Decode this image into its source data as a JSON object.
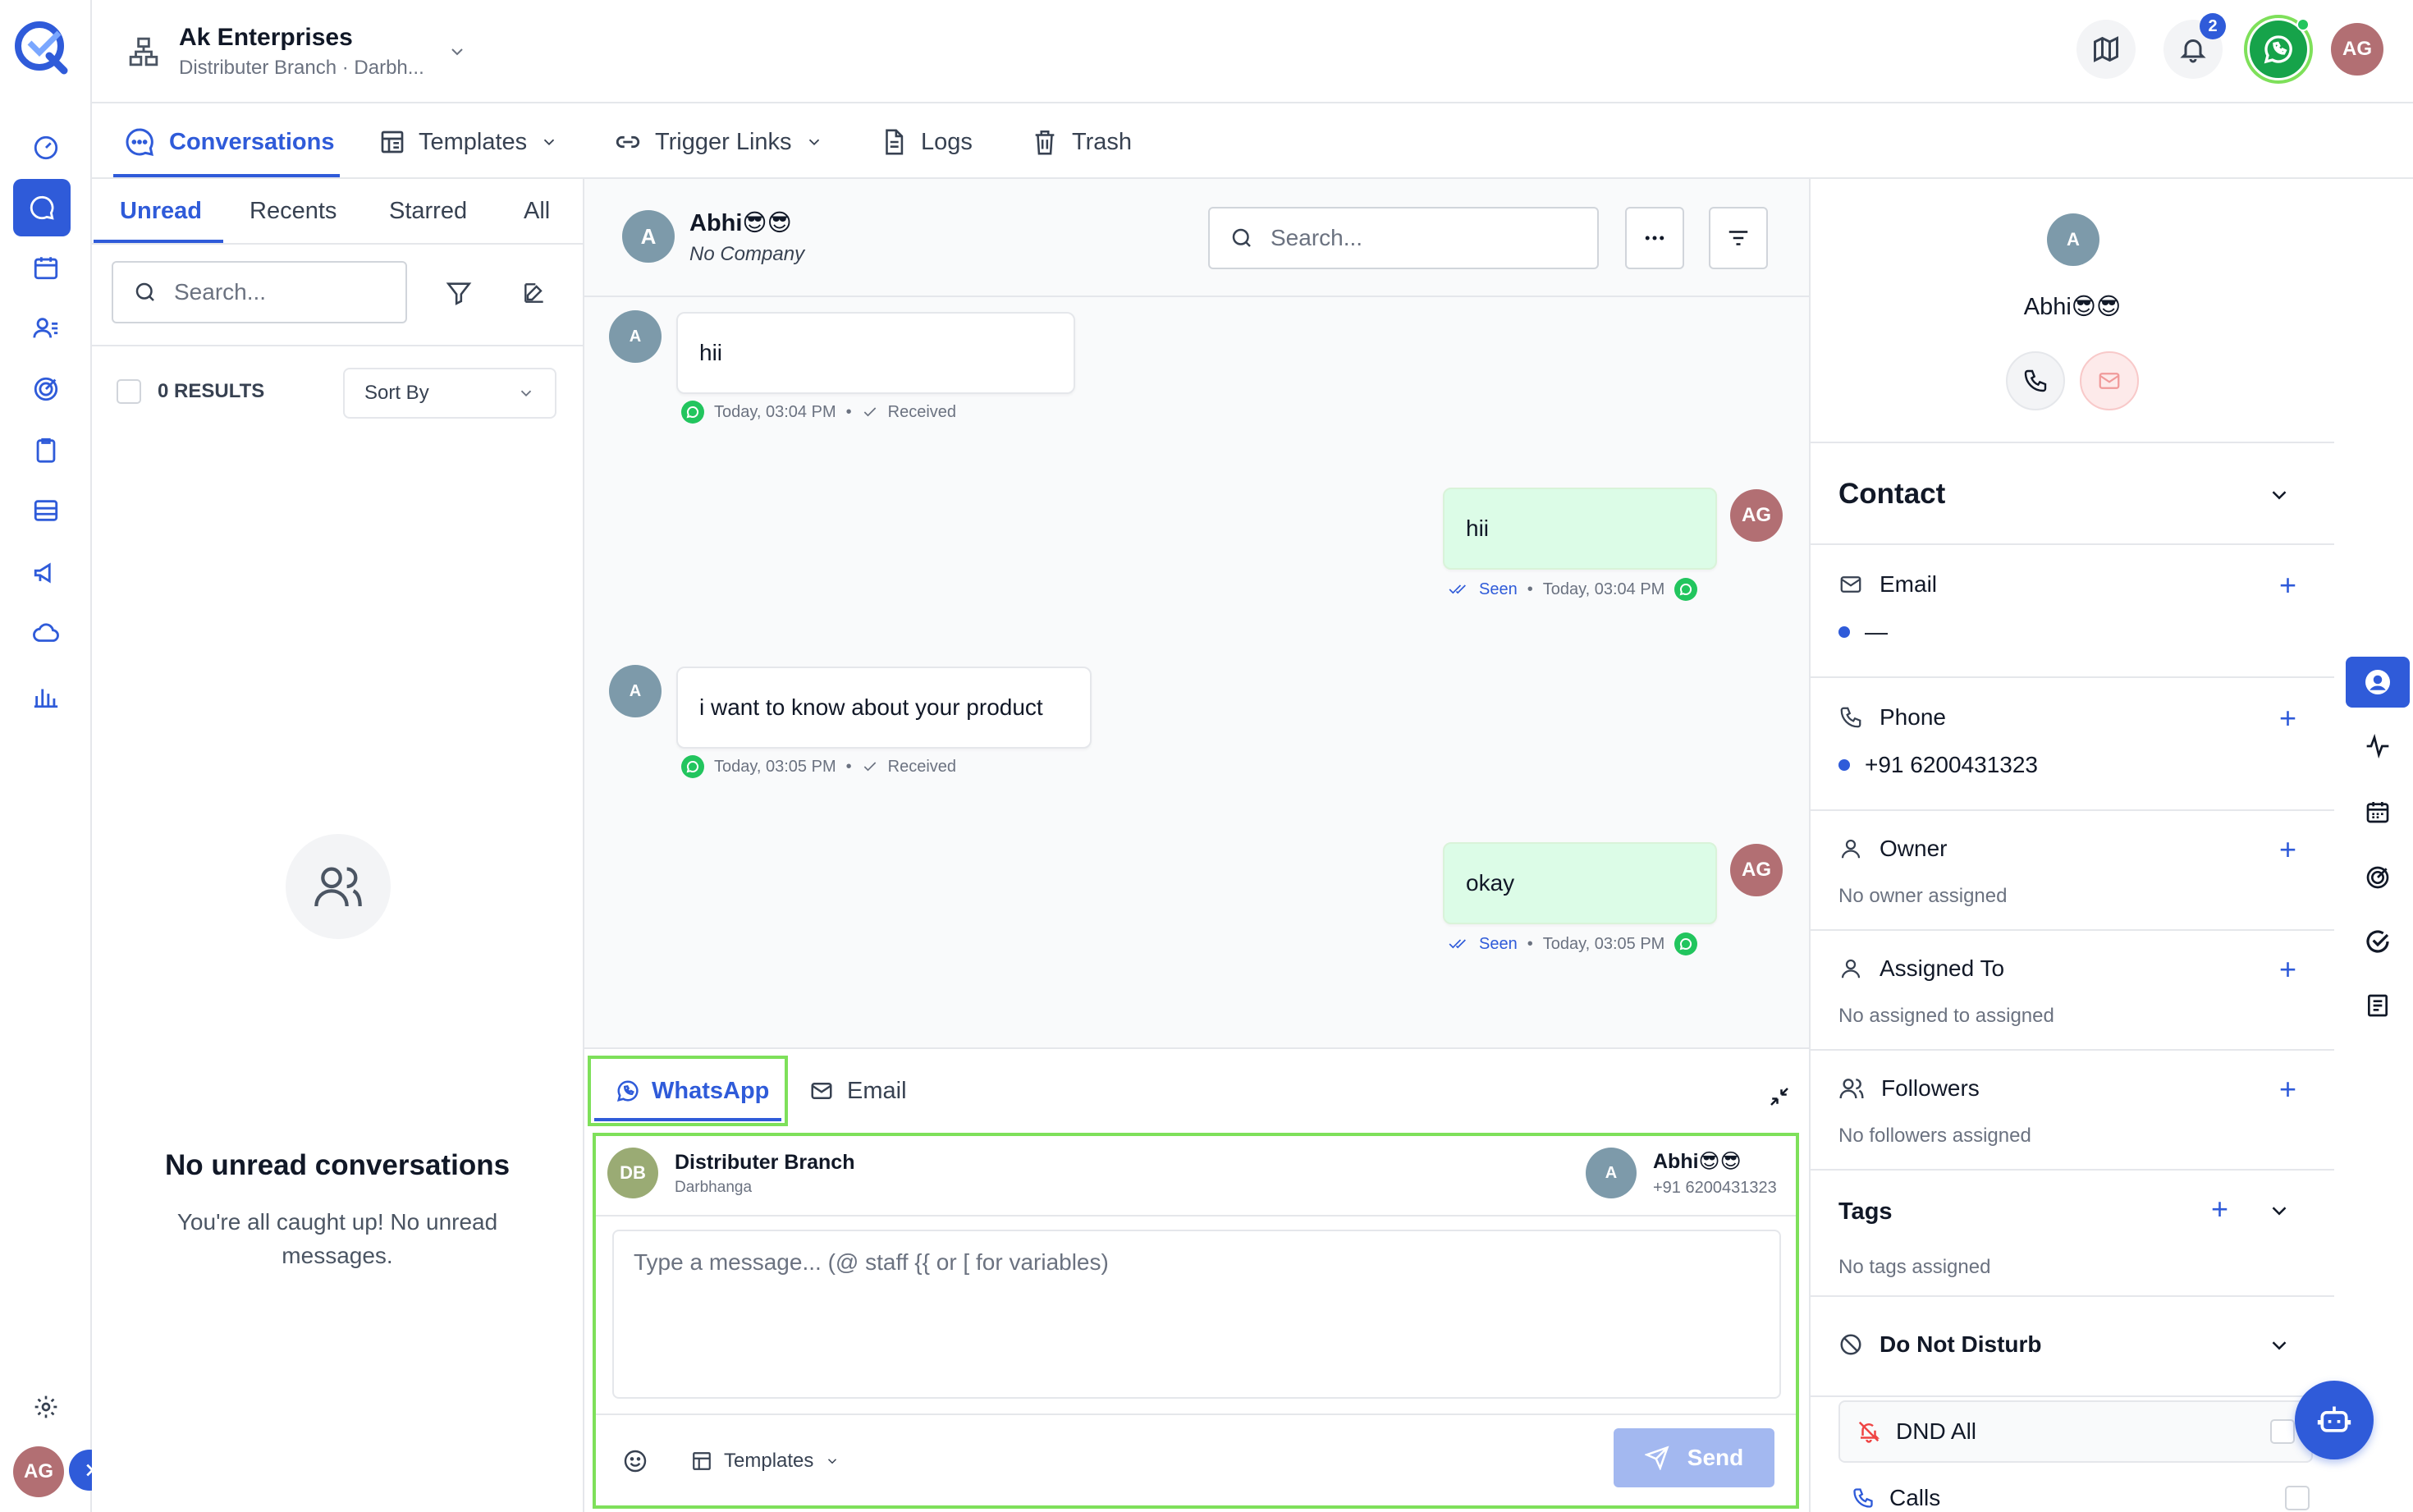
{
  "org": {
    "name": "Ak Enterprises",
    "subtitle": "Distributer Branch · Darbh..."
  },
  "header": {
    "notification_count": "2",
    "user_initials": "AG"
  },
  "nav_tabs": [
    {
      "label": "Conversations"
    },
    {
      "label": "Templates"
    },
    {
      "label": "Trigger Links"
    },
    {
      "label": "Logs"
    },
    {
      "label": "Trash"
    }
  ],
  "list": {
    "tabs": [
      "Unread",
      "Recents",
      "Starred",
      "All"
    ],
    "search_placeholder": "Search...",
    "results": "0 RESULTS",
    "sort_label": "Sort By",
    "empty_title": "No unread conversations",
    "empty_text": "You're all caught up! No unread messages."
  },
  "chat": {
    "contact_initial": "A",
    "contact_name": "Abhi😎😎",
    "contact_company": "No Company",
    "search_placeholder": "Search...",
    "messages": [
      {
        "text": "hii",
        "time": "Today, 03:04 PM",
        "status": "Received"
      },
      {
        "text": "hii",
        "time": "Today, 03:04 PM",
        "status": "Seen"
      },
      {
        "text": "i want to know about your product",
        "time": "Today, 03:05 PM",
        "status": "Received"
      },
      {
        "text": "okay",
        "time": "Today, 03:05 PM",
        "status": "Seen"
      }
    ]
  },
  "composer": {
    "channels": [
      "WhatsApp",
      "Email"
    ],
    "from_initials": "DB",
    "from_name": "Distributer Branch",
    "from_sub": "Darbhanga",
    "to_name": "Abhi😎😎",
    "to_phone": "+91 6200431323",
    "placeholder": "Type a message... (@ staff  {{ or [ for variables)",
    "templates_label": "Templates",
    "send_label": "Send"
  },
  "contact_panel": {
    "name": "Abhi😎😎",
    "section_title": "Contact",
    "email_label": "Email",
    "email_value": "—",
    "phone_label": "Phone",
    "phone_value": "+91 6200431323",
    "owner_label": "Owner",
    "owner_value": "No owner assigned",
    "assigned_label": "Assigned To",
    "assigned_value": "No assigned to assigned",
    "followers_label": "Followers",
    "followers_value": "No followers assigned",
    "tags_label": "Tags",
    "tags_value": "No tags assigned",
    "dnd_label": "Do Not Disturb",
    "dnd_all_label": "DND All",
    "calls_label": "Calls"
  },
  "colors": {
    "accent": "#2f5bd9",
    "whatsapp": "#22c55e",
    "outgoing_bubble": "#dcfce7",
    "highlight": "#7ee05a"
  }
}
